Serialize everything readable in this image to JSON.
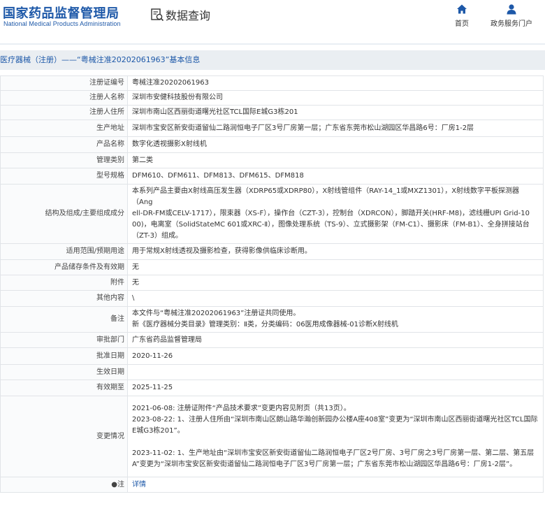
{
  "header": {
    "logo_cn": "国家药品监督管理局",
    "logo_en": "National Medical Products Administration",
    "query_label": "数据查询",
    "nav": [
      {
        "label": "首页",
        "icon": "home-icon"
      },
      {
        "label": "政务服务门户",
        "icon": "user-icon"
      }
    ]
  },
  "breadcrumb": "医疗器械（注册）——“粤械注准20202061963”基本信息",
  "colors": {
    "brand": "#1d58a8",
    "crumb_bg": "#eaeef2",
    "border": "#e1e4e8"
  },
  "rows": [
    {
      "key": "注册证编号",
      "value": "粤械注准20202061963"
    },
    {
      "key": "注册人名称",
      "value": "深圳市安健科技股份有限公司"
    },
    {
      "key": "注册人住所",
      "value": "深圳市南山区西丽街道曙光社区TCL国际E城G3栋201"
    },
    {
      "key": "生产地址",
      "value": "深圳市宝安区新安街道留仙二路润恒电子厂区3号厂房第一层；广东省东莞市松山湖园区华昌路6号：厂房1-2层"
    },
    {
      "key": "产品名称",
      "value": "数字化透视摄影X射线机"
    },
    {
      "key": "管理类别",
      "value": "第二类"
    },
    {
      "key": "型号规格",
      "value": "DFM610、DFM611、DFM813、DFM615、DFM818"
    },
    {
      "key": "结构及组成/主要组成成分",
      "lines": [
        "本系列产品主要由X射线高压发生器（XDRP65或XDRP80），X射线管组件（RAY-14_1或MXZ1301），X射线数字平板探测器（Ang",
        "ell-DR-FM或CELV-1717），限束器（XS-F），操作台（CZT-3），控制台（XDRCON），脚踏开关(HRF-M8)，滤线栅UPI Grid-10",
        "00)，电离室（SolidStateMC 601或XRC-Ⅱ），图像处理系统（TS-9）、立式摄影架（FM-C1）、摄影床（FM-B1）、全身拼接站台",
        "（ZT-3）组成。"
      ]
    },
    {
      "key": "适用范围/预期用途",
      "value": "用于常规X射线透视及摄影检查，获得影像供临床诊断用。"
    },
    {
      "key": "产品储存条件及有效期",
      "value": "无"
    },
    {
      "key": "附件",
      "value": "无"
    },
    {
      "key": "其他内容",
      "value": "\\"
    },
    {
      "key": "备注",
      "lines": [
        "本文件与“粤械注准20202061963”注册证共同使用。",
        "新《医疗器械分类目录》管理类别：Ⅱ类，分类编码：06医用成像器械-01诊断X射线机"
      ]
    },
    {
      "key": "审批部门",
      "value": "广东省药品监督管理局"
    },
    {
      "key": "批准日期",
      "value": "2020-11-26"
    },
    {
      "key": "生效日期",
      "value": ""
    },
    {
      "key": "有效期至",
      "value": "2025-11-25"
    },
    {
      "key": "变更情况",
      "lines": [
        "2021-06-08: 注册证附件“产品技术要求”变更内容见附页（共13页）。",
        "2023-08-22: 1、注册人住所由“深圳市南山区朗山路华瀚创新园办公楼A座408室”变更为“深圳市南山区西丽街道曙光社区TCL国际",
        "E城G3栋201”。",
        "",
        "2023-11-02: 1、生产地址由“深圳市宝安区新安街道留仙二路润恒电子厂区2号厂房、3号厂房之3号厂房第一层、第二层、第五层",
        "A”变更为“深圳市宝安区新安街道留仙二路润恒电子厂区3号厂房第一层；广东省东莞市松山湖园区华昌路6号：厂房1-2层”。"
      ]
    },
    {
      "key": "●注",
      "link": "详情"
    }
  ]
}
